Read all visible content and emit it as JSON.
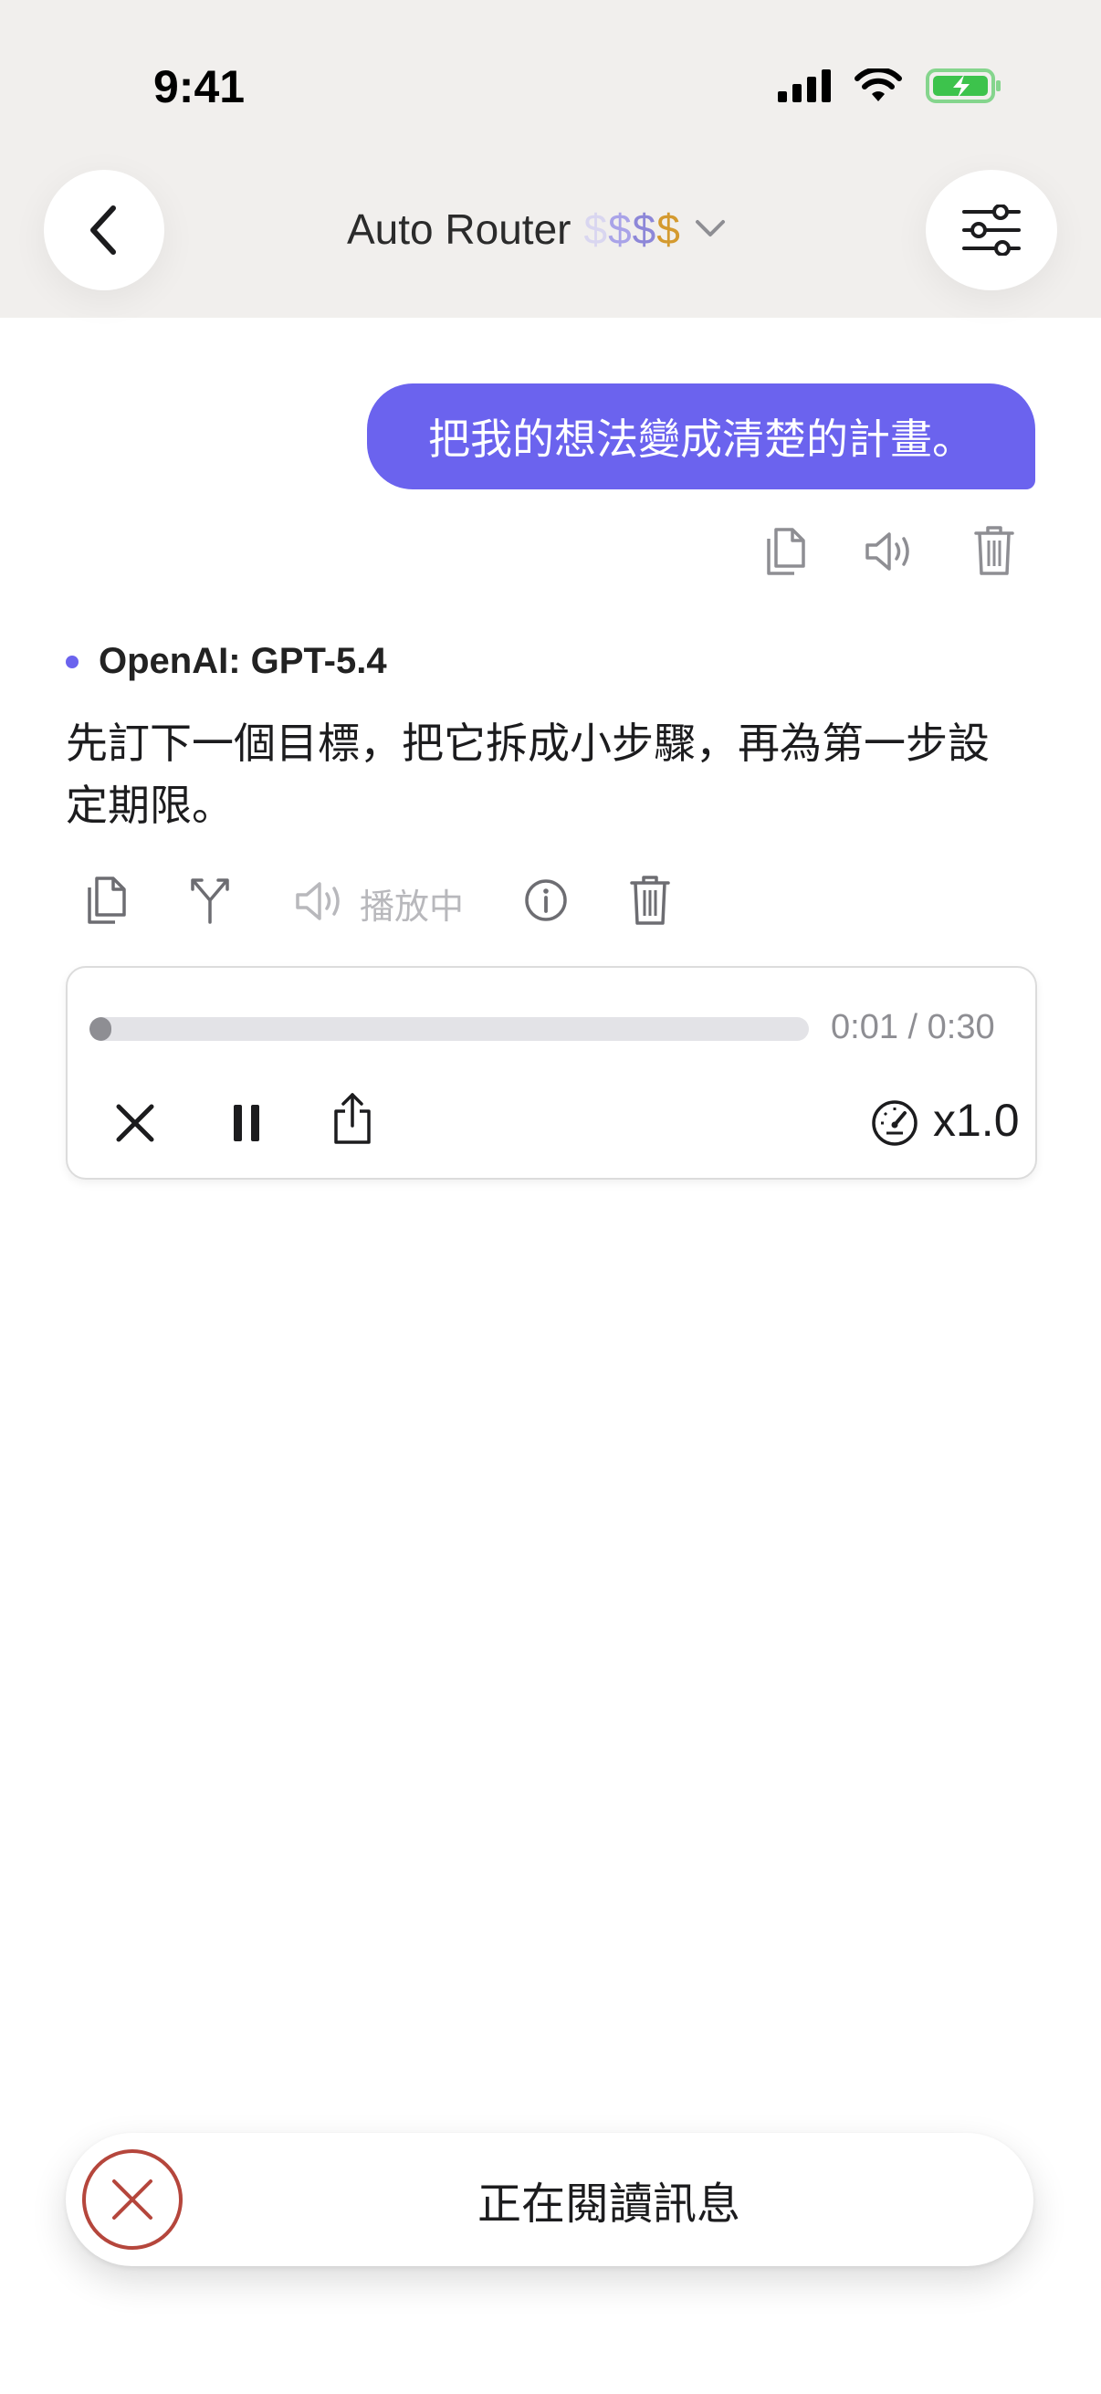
{
  "status_bar": {
    "time": "9:41",
    "icons": [
      "cellular-signal-icon",
      "wifi-icon",
      "battery-charging-icon"
    ],
    "battery_color": "#3dc34c"
  },
  "header": {
    "back_icon": "chevron-left-icon",
    "model_name": "Auto Router",
    "price_tier": [
      "$",
      "$",
      "$",
      "$"
    ],
    "dropdown_icon": "chevron-down-icon",
    "settings_icon": "sliders-icon"
  },
  "conversation": {
    "user_message": "把我的想法變成清楚的計畫。",
    "user_actions": [
      "copy-icon",
      "speaker-icon",
      "trash-icon"
    ],
    "assistant": {
      "model_label": "OpenAI: GPT-5.4",
      "reply": "先訂下一個目標，把它拆成小步驟，再為第一步設定期限。",
      "actions": [
        "copy-icon",
        "branch-icon",
        "speaker-icon",
        "info-icon",
        "trash-icon"
      ],
      "playing_label": "播放中"
    }
  },
  "audio_player": {
    "progress": 0.03,
    "time_display": "0:01 / 0:30",
    "speed_label": "x1.0",
    "controls": [
      "close-icon",
      "pause-icon",
      "share-icon",
      "speedometer-icon"
    ]
  },
  "reading_bar": {
    "label": "正在閱讀訊息",
    "stop_icon": "stop-circle-icon",
    "stop_color": "#b5463c"
  },
  "colors": {
    "accent": "#6b63ee",
    "header_bg": "#f1efed"
  }
}
